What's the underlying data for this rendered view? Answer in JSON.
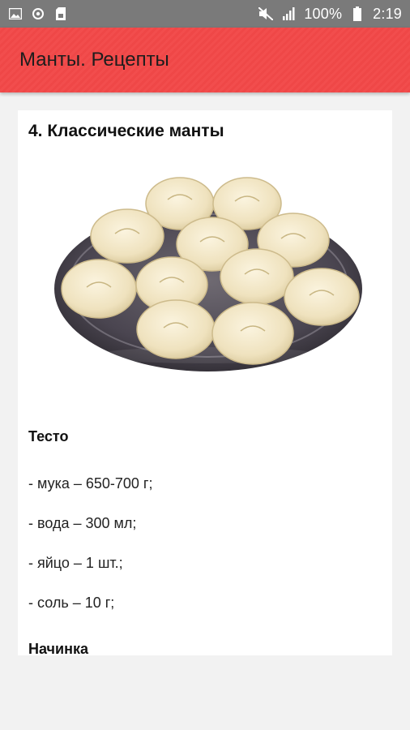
{
  "status_bar": {
    "battery": "100%",
    "time": "2:19",
    "icons": [
      "image-icon",
      "sync-icon",
      "sd-card-icon",
      "mute-icon",
      "signal-icon",
      "battery-icon"
    ]
  },
  "app_bar": {
    "title": "Манты. Рецепты",
    "color": "#f24d4d"
  },
  "recipe": {
    "title": "4. Классические манты",
    "image": "manti-plate",
    "dough_heading": "Тесто",
    "dough": [
      "- мука – 650-700 г;",
      "- вода – 300 мл;",
      "- яйцо – 1 шт.;",
      "- соль – 10 г;"
    ],
    "filling_heading": "Начинка"
  }
}
